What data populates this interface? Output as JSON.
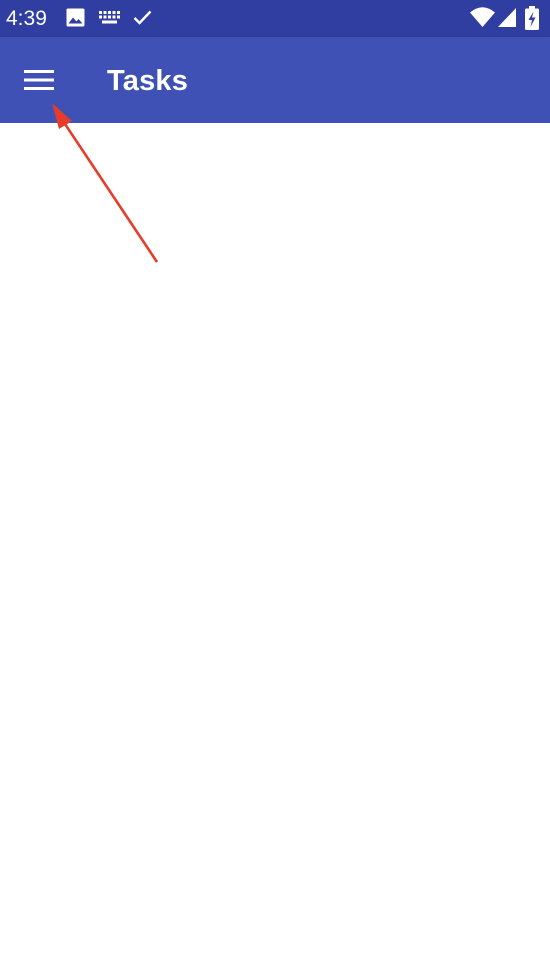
{
  "status_bar": {
    "time": "4:39",
    "left_icons": [
      "image-icon",
      "keyboard-icon",
      "check-icon"
    ],
    "right_icons": [
      "wifi-icon",
      "signal-icon",
      "battery-charging-icon"
    ]
  },
  "app_bar": {
    "title": "Tasks",
    "menu_icon": "hamburger-menu-icon"
  },
  "colors": {
    "status_bar": "#2f3ea0",
    "app_bar": "#3f51b5",
    "annotation_arrow": "#e53c2c",
    "background": "#ffffff"
  }
}
